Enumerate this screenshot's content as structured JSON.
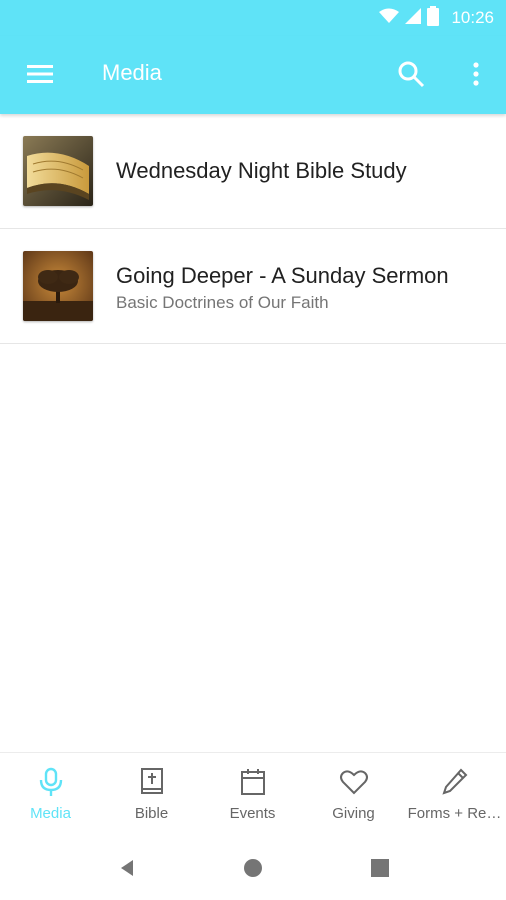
{
  "status": {
    "time": "10:26"
  },
  "appbar": {
    "title": "Media"
  },
  "media_items": [
    {
      "title": "Wednesday Night Bible Study",
      "subtitle": ""
    },
    {
      "title": "Going Deeper - A Sunday Sermon",
      "subtitle": "Basic Doctrines of Our Faith"
    }
  ],
  "bottom_nav": {
    "tabs": [
      {
        "label": "Media",
        "icon": "microphone-icon"
      },
      {
        "label": "Bible",
        "icon": "bible-icon"
      },
      {
        "label": "Events",
        "icon": "calendar-icon"
      },
      {
        "label": "Giving",
        "icon": "heart-icon"
      },
      {
        "label": "Forms + Re…",
        "icon": "pencil-icon"
      }
    ],
    "active_index": 0
  },
  "colors": {
    "accent": "#5fe3f7",
    "text_primary": "#212121",
    "text_secondary": "#757575"
  }
}
